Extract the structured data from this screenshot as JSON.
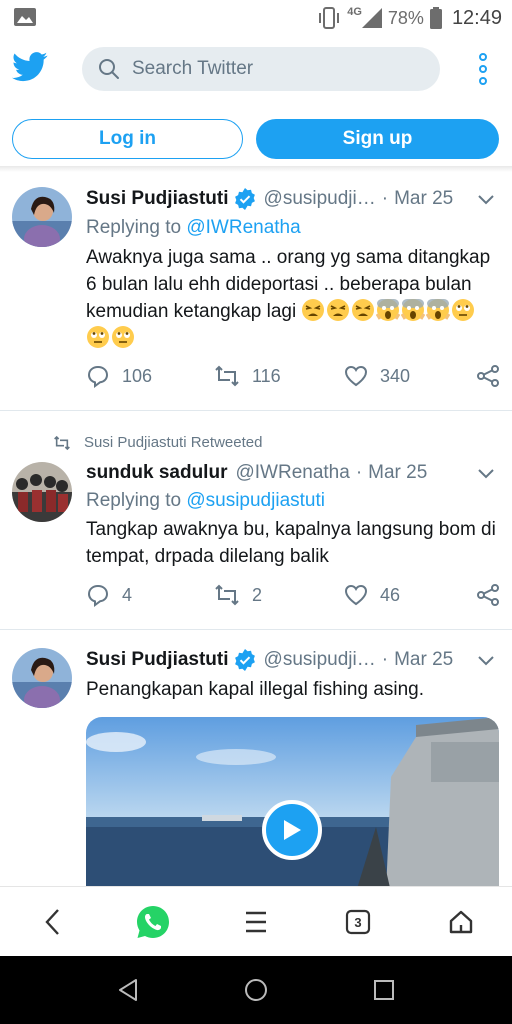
{
  "status_bar": {
    "network": "4G",
    "battery": "78%",
    "time": "12:49"
  },
  "header": {
    "logo": "twitter-bird-icon",
    "search_placeholder": "Search Twitter",
    "login_label": "Log in",
    "signup_label": "Sign up"
  },
  "tweets": [
    {
      "name": "Susi Pudjiastuti",
      "handle": "@susipudji…",
      "date": "Mar 25",
      "replying_prefix": "Replying to ",
      "replying_to": "@IWRenatha",
      "text": "Awaknya juga sama .. orang yg sama ditangkap 6 bulan lalu ehh dideportasi .. beberapa bulan kemudian ketangkap lagi",
      "emojis": [
        "tired-face",
        "tired-face",
        "tired-face",
        "screaming-face",
        "screaming-face",
        "screaming-face",
        "eye-roll-face",
        "eye-roll-face",
        "eye-roll-face"
      ],
      "replies": "106",
      "retweets": "116",
      "likes": "340"
    },
    {
      "retweeted_by": "Susi Pudjiastuti Retweeted",
      "name": "sunduk sadulur",
      "handle": "@IWRenatha",
      "date": "Mar 25",
      "replying_prefix": "Replying to ",
      "replying_to": "@susipudjiastuti",
      "text": "Tangkap awaknya bu, kapalnya langsung bom di tempat, drpada dilelang balik",
      "replies": "4",
      "retweets": "2",
      "likes": "46"
    },
    {
      "name": "Susi Pudjiastuti",
      "handle": "@susipudji…",
      "date": "Mar 25",
      "text": "Penangkapan kapal illegal fishing asing.",
      "media": "video-thumbnail"
    }
  ],
  "browser_bar": {
    "tab_count": "3"
  },
  "colors": {
    "accent": "#1da1f2",
    "muted": "#657786",
    "text": "#14171a"
  }
}
